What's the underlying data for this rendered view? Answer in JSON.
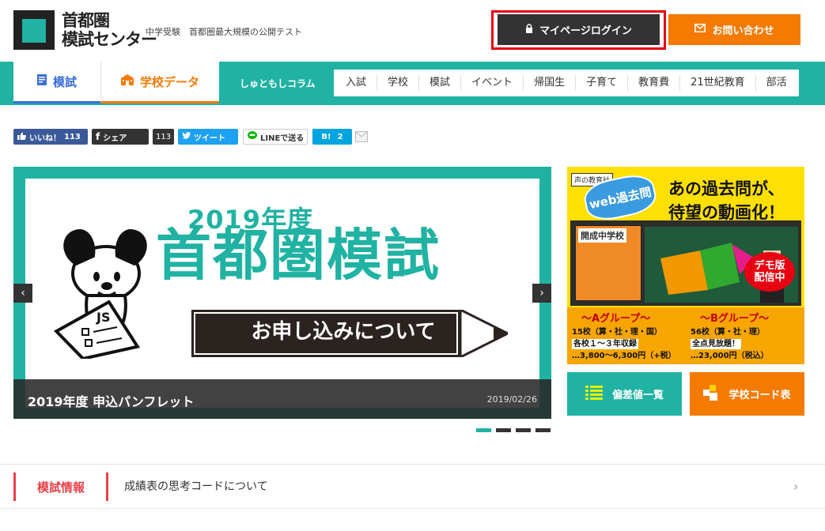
{
  "header": {
    "logo_line1": "首都圏",
    "logo_line2": "模試センター",
    "tagline": "中学受験　首都圏最大規模の公開テスト",
    "login_label": "マイページログイン",
    "contact_label": "お問い合わせ"
  },
  "nav": {
    "tab_moshi": "模試",
    "tab_school": "学校データ",
    "column_label": "しゅともしコラム",
    "items": [
      "入試",
      "学校",
      "模試",
      "イベント",
      "帰国生",
      "子育て",
      "教育費",
      "21世紀教育",
      "部活"
    ]
  },
  "social": {
    "like_label": "いいね！",
    "like_count": "113",
    "share_label": "シェア",
    "share_count": "113",
    "tweet_label": "ツイート",
    "line_label": "LINEで送る",
    "hatena_label": "B!",
    "hatena_count": "2"
  },
  "carousel": {
    "slide_year": "2019年度",
    "slide_main": "首都圏模試",
    "slide_sub": "お申し込みについて",
    "caption_title": "2019年度 申込パンフレット",
    "caption_date": "2019/02/26",
    "prev_icon": "‹",
    "next_icon": "›"
  },
  "ad": {
    "publisher": "声の教育社",
    "badge": "web過去問",
    "headline1": "あの過去問が、",
    "headline2": "待望の動画化！",
    "book_title": "開成中学校",
    "demo1": "デモ版",
    "demo2": "配信中",
    "group_a_title": "～Aグループ～",
    "group_a_line1": "15校（算・社・理・国）",
    "group_a_line2": "各校１～３年収録",
    "group_a_line3": "…3,800～6,300円（+税）",
    "group_b_title": "～Bグループ～",
    "group_b_line1": "56校（算・社・理）",
    "group_b_line2": "全点見放題！",
    "group_b_line3": "…23,000円（税込）"
  },
  "quick_links": {
    "hensachi": "偏差値一覧",
    "schoolcode": "学校コード表"
  },
  "news": {
    "label": "模試情報",
    "text": "成績表の思考コードについて",
    "chevron": "›"
  },
  "colors": {
    "teal": "#20b2a2",
    "orange": "#f57a00",
    "dark": "#333333",
    "red": "#e60012"
  }
}
